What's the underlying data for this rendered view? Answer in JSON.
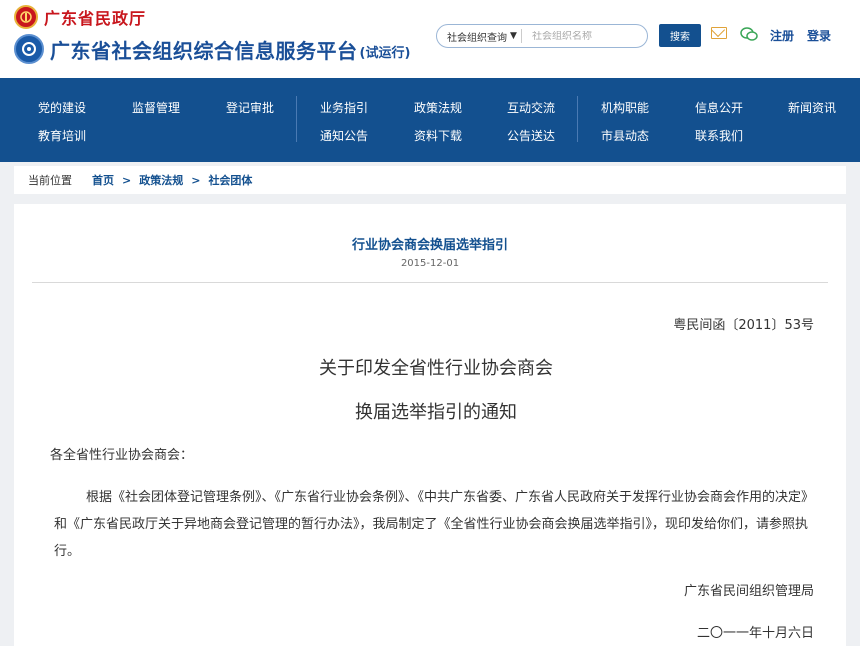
{
  "header": {
    "org_name": "广东省民政厅",
    "site_title": "广东省社会组织综合信息服务平台",
    "site_title_suffix": "(试运行)",
    "search": {
      "select_value": "社会组织查询",
      "placeholder": "社会组织名称",
      "button_label": "搜索"
    },
    "icons": [
      "mail-icon",
      "wechat-icon"
    ],
    "register_label": "注册",
    "login_label": "登录"
  },
  "nav": {
    "row1": [
      "党的建设",
      "监督管理",
      "登记审批",
      "业务指引",
      "政策法规",
      "互动交流",
      "机构职能",
      "信息公开",
      "新闻资讯"
    ],
    "row2": [
      "教育培训",
      "通知公告",
      "资料下载",
      "公告送达",
      "市县动态",
      "联系我们"
    ]
  },
  "breadcrumb": {
    "label": "当前位置",
    "items": [
      "首页",
      "政策法规",
      "社会团体"
    ],
    "separator": ">"
  },
  "article": {
    "title": "行业协会商会换届选举指引",
    "date": "2015-12-01",
    "doc_number": "粤民间函〔2011〕53号",
    "doc_title_line1": "关于印发全省性行业协会商会",
    "doc_title_line2": "换届选举指引的通知",
    "salutation": "各全省性行业协会商会：",
    "body": "根据《社会团体登记管理条例》、《广东省行业协会条例》、《中共广东省委、广东省人民政府关于发挥行业协会商会作用的决定》和《广东省民政厅关于异地商会登记管理的暂行办法》，我局制定了《全省性行业协会商会换届选举指引》，现印发给你们，请参照执行。",
    "signer": "广东省民间组织管理局",
    "sign_date": "二〇一一年十月六日"
  },
  "colors": {
    "primary_blue": "#13508f",
    "brand_red": "#c8161d",
    "page_bg": "#eef0f3"
  }
}
